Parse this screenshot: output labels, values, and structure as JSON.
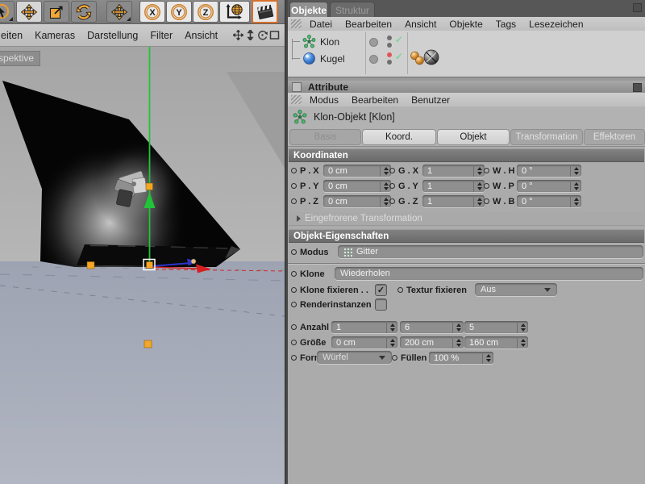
{
  "colors": {
    "accent_orange": "#F2A838",
    "axis_green": "#21C437",
    "axis_red": "#D42020",
    "axis_blue": "#2B35C8",
    "handle_orange": "#F5A623",
    "selection_outline": "#FFFFFF"
  },
  "toolbar": {
    "tools": [
      {
        "name": "live-selection"
      },
      {
        "name": "move"
      },
      {
        "name": "scale"
      },
      {
        "name": "rotate"
      },
      {
        "name": "move-axis"
      },
      {
        "name": "lock-x",
        "letter": "X"
      },
      {
        "name": "lock-y",
        "letter": "Y"
      },
      {
        "name": "lock-z",
        "letter": "Z"
      },
      {
        "name": "coordinate-system"
      },
      {
        "name": "render-view"
      }
    ],
    "menu": [
      "eiten",
      "Kameras",
      "Darstellung",
      "Filter",
      "Ansicht"
    ]
  },
  "viewport": {
    "label": "rspektive"
  },
  "object_manager": {
    "tabs": [
      {
        "label": "Objekte"
      },
      {
        "label": "Struktur"
      }
    ],
    "menu": [
      "Datei",
      "Bearbeiten",
      "Ansicht",
      "Objekte",
      "Tags",
      "Lesezeichen"
    ],
    "objects": [
      {
        "name": "Klon"
      },
      {
        "name": "Kugel"
      }
    ]
  },
  "attributes": {
    "title": "Attribute",
    "menu": [
      "Modus",
      "Bearbeiten",
      "Benutzer"
    ],
    "object_header": "Klon-Objekt [Klon]",
    "tabs": [
      "Basis",
      "Koord.",
      "Objekt",
      "Transformation",
      "Effektoren"
    ],
    "koordinaten": {
      "title": "Koordinaten",
      "rows": [
        {
          "p_label": "P . X",
          "p": "0 cm",
          "g_label": "G . X",
          "g": "1",
          "w_label": "W . H",
          "w": "0 °"
        },
        {
          "p_label": "P . Y",
          "p": "0 cm",
          "g_label": "G . Y",
          "g": "1",
          "w_label": "W . P",
          "w": "0 °"
        },
        {
          "p_label": "P . Z",
          "p": "0 cm",
          "g_label": "G . Z",
          "g": "1",
          "w_label": "W . B",
          "w": "0 °"
        }
      ],
      "collapsed": "Eingefrorene Transformation"
    },
    "objekt": {
      "title": "Objekt-Eigenschaften",
      "modus_label": "Modus",
      "modus_value": "Gitter",
      "klone_label": "Klone",
      "klone_value": "Wiederholen",
      "klone_fixieren_label": "Klone fixieren . .",
      "textur_fixieren_label": "Textur fixieren",
      "textur_fixieren_value": "Aus",
      "renderinstanzen_label": "Renderinstanzen",
      "anzahl_label": "Anzahl",
      "anzahl": [
        "1",
        "6",
        "5"
      ],
      "groesse_label": "Größe",
      "groesse": [
        "0 cm",
        "200 cm",
        "160 cm"
      ],
      "form_label": "Form",
      "form_value": "Würfel",
      "fuellen_label": "Füllen",
      "fuellen_value": "100 %"
    }
  }
}
